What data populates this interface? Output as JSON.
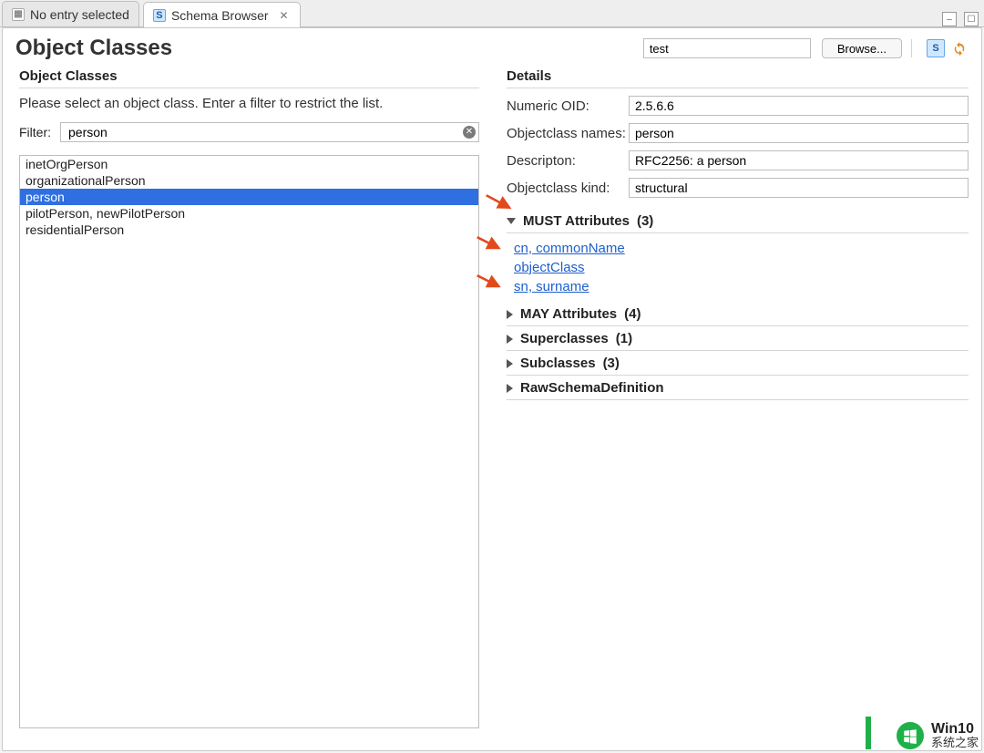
{
  "tabs": [
    {
      "label": "No entry selected",
      "active": false,
      "icon": "grid"
    },
    {
      "label": "Schema Browser",
      "active": true,
      "icon": "schema",
      "closable": true
    }
  ],
  "title": "Object Classes",
  "search": {
    "value": "test",
    "browse_label": "Browse..."
  },
  "left": {
    "heading": "Object Classes",
    "hint": "Please select an object class. Enter a filter to restrict the list.",
    "filter_label": "Filter:",
    "filter_value": "person",
    "items": [
      {
        "label": "inetOrgPerson",
        "selected": false
      },
      {
        "label": "organizationalPerson",
        "selected": false
      },
      {
        "label": "person",
        "selected": true
      },
      {
        "label": "pilotPerson, newPilotPerson",
        "selected": false
      },
      {
        "label": "residentialPerson",
        "selected": false
      }
    ]
  },
  "right": {
    "heading": "Details",
    "fields": [
      {
        "label": "Numeric OID:",
        "value": "2.5.6.6"
      },
      {
        "label": "Objectclass names:",
        "value": "person"
      },
      {
        "label": "Descripton:",
        "value": "RFC2256: a person"
      },
      {
        "label": "Objectclass kind:",
        "value": "structural"
      }
    ],
    "must": {
      "title": "MUST Attributes",
      "count": "(3)",
      "expanded": true,
      "links": [
        "cn, commonName",
        "objectClass",
        "sn, surname"
      ]
    },
    "sections": [
      {
        "title": "MAY Attributes",
        "count": "(4)"
      },
      {
        "title": "Superclasses",
        "count": "(1)"
      },
      {
        "title": "Subclasses",
        "count": "(3)"
      },
      {
        "title": "RawSchemaDefinition",
        "count": ""
      }
    ]
  },
  "watermark": {
    "line1": "Win10",
    "line2": "系统之家"
  }
}
